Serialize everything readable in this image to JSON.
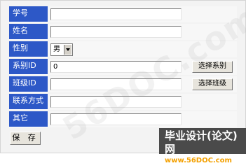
{
  "form": {
    "fields": [
      {
        "label": "学号",
        "value": ""
      },
      {
        "label": "姓名",
        "value": ""
      },
      {
        "label": "性别",
        "value": "男"
      },
      {
        "label": "系别ID",
        "value": "0",
        "button": "选择系别"
      },
      {
        "label": "班级ID",
        "value": "",
        "button": "选择班级"
      },
      {
        "label": "联系方式",
        "value": ""
      },
      {
        "label": "其它",
        "value": ""
      }
    ],
    "save_label": "保 存"
  },
  "watermark": {
    "text": "56DOC.com"
  },
  "branding": {
    "title": "毕业设计(论文)网",
    "url": "www.56DOC.com"
  },
  "colors": {
    "label_background": "#2d58c7",
    "brand_background": "#4a4a4a",
    "brand_url": "#f3a000"
  }
}
